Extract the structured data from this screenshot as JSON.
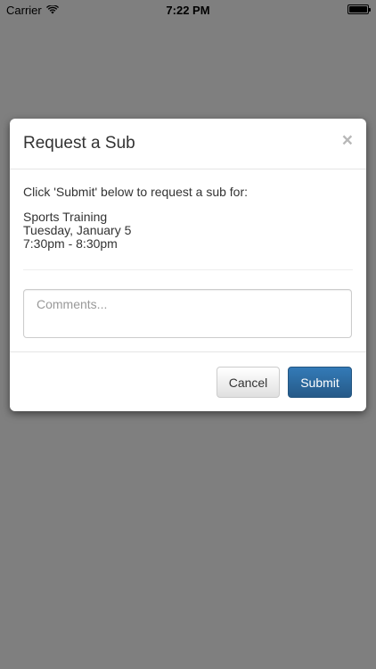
{
  "status_bar": {
    "carrier": "Carrier",
    "time": "7:22 PM",
    "battery_level": 1.0
  },
  "modal": {
    "title": "Request a Sub",
    "close_symbol": "×",
    "intro": "Click 'Submit' below to request a sub for:",
    "event": {
      "name": "Sports Training",
      "date": "Tuesday, January 5",
      "time_range": "7:30pm - 8:30pm"
    },
    "comments": {
      "value": "",
      "placeholder": "Comments..."
    },
    "buttons": {
      "cancel_label": "Cancel",
      "submit_label": "Submit"
    }
  },
  "colors": {
    "overlay": "#7f7f7f",
    "primary": "#337ab7",
    "text": "#333333"
  }
}
